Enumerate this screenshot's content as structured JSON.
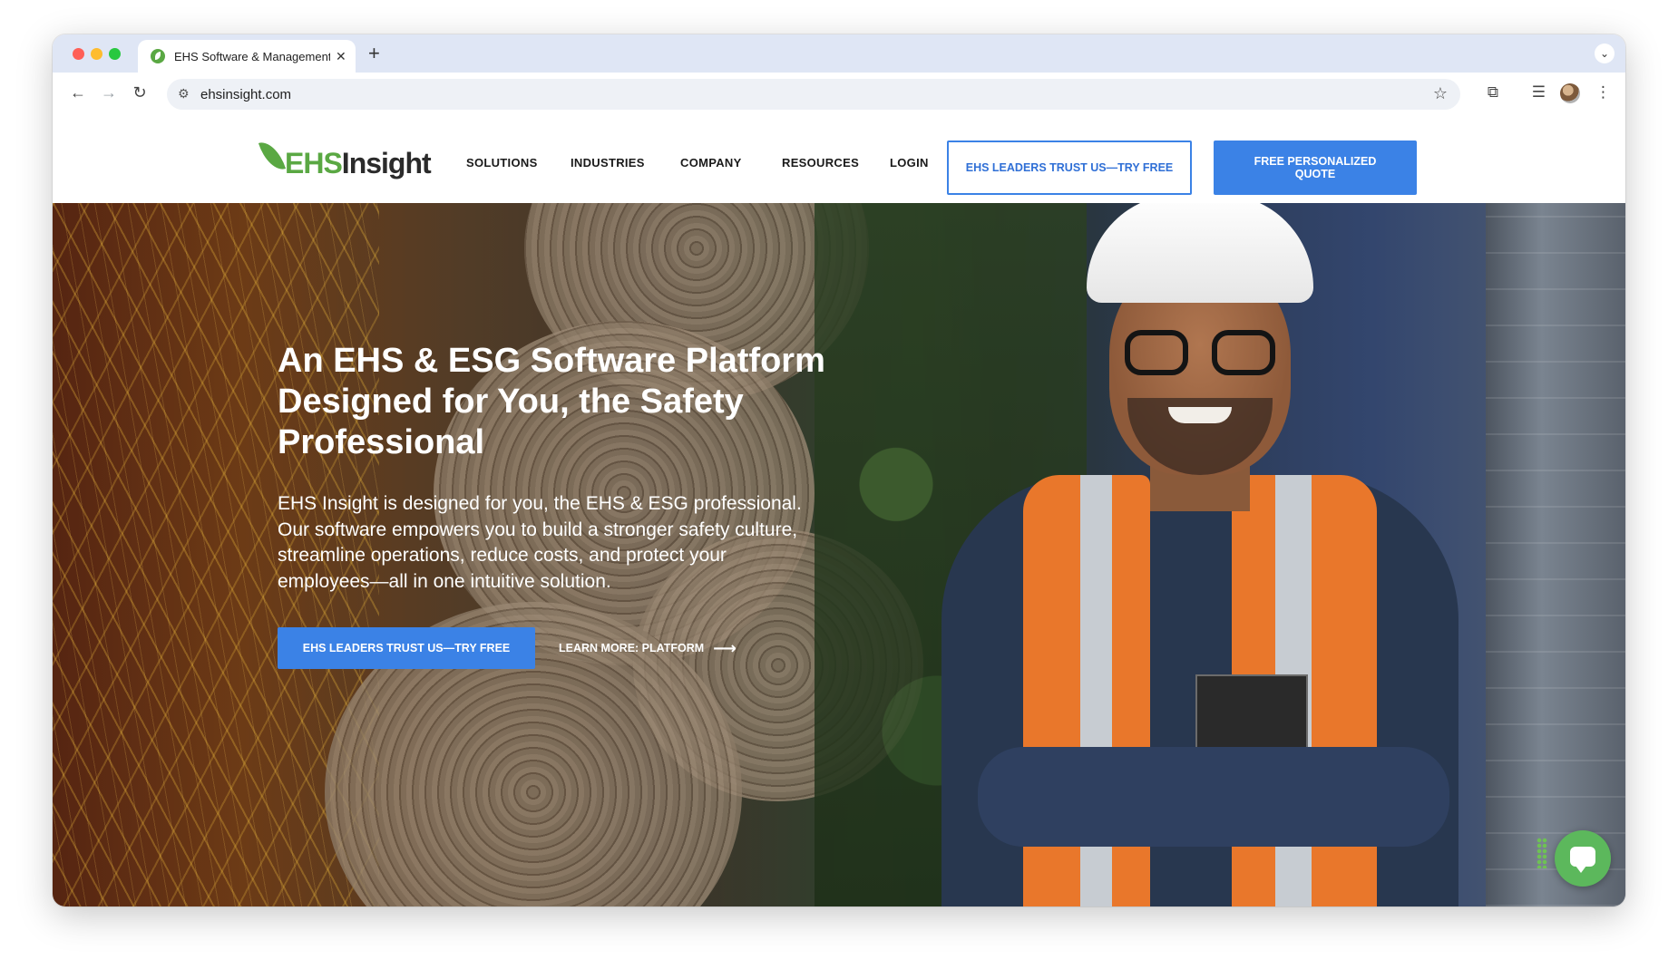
{
  "browser": {
    "tab_title": "EHS Software & Management",
    "tab_close": "✕",
    "new_tab": "+",
    "url": "ehsinsight.com",
    "icons": [
      "back-arrow-icon",
      "forward-arrow-icon",
      "reload-icon",
      "site-info-icon",
      "star-icon",
      "extensions-icon",
      "reading-list-icon",
      "profile-avatar",
      "more-menu-icon"
    ]
  },
  "site": {
    "logo": {
      "ehs": "EHS",
      "insight": "Insight"
    },
    "nav": [
      "SOLUTIONS",
      "INDUSTRIES",
      "COMPANY",
      "RESOURCES",
      "LOGIN"
    ],
    "cta_outline": "EHS LEADERS TRUST US—TRY FREE",
    "cta_solid": "FREE PERSONALIZED QUOTE"
  },
  "hero": {
    "title": "An EHS & ESG Software Platform Designed for You, the Safety Professional",
    "body": "EHS Insight is designed for you, the EHS & ESG professional. Our software empowers you to build a stronger safety culture, streamline operations, reduce costs, and protect your employees—all in one intuitive solution.",
    "cta": "EHS LEADERS TRUST US—TRY FREE",
    "link": "LEARN MORE: PLATFORM",
    "link_arrow": "⟶"
  },
  "colors": {
    "brand_green": "#5aa843",
    "primary_blue": "#3b82e6",
    "chat_green": "#5cb85c"
  }
}
